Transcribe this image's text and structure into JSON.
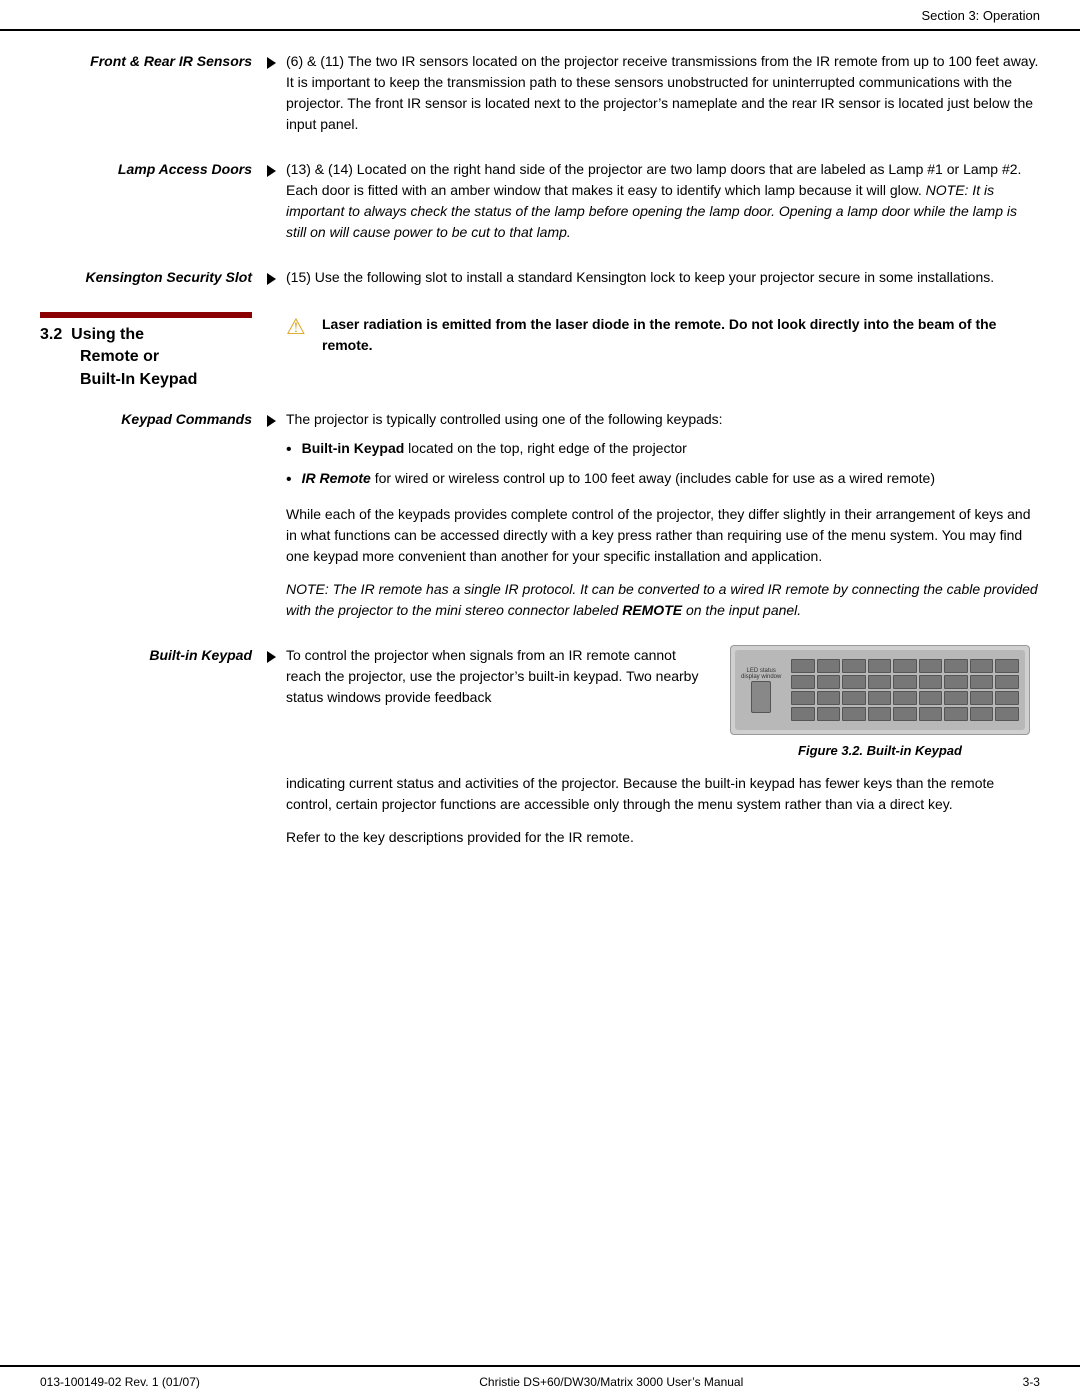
{
  "header": {
    "text": "Section 3: Operation"
  },
  "entries": [
    {
      "id": "front-rear-ir",
      "label": "Front & Rear IR Sensors",
      "content": "(6) & (11) The two IR sensors located on the projector receive transmissions from the IR remote from up to 100 feet away. It is important to keep the transmission path to these sensors unobstructed for uninterrupted communications with the projector. The front IR sensor is located next to the projector’s nameplate and the rear IR sensor is located just below the input panel."
    },
    {
      "id": "lamp-access",
      "label": "Lamp Access Doors",
      "content_parts": [
        "(13) & (14) Located on the right hand side of the projector are two lamp doors that are labeled as Lamp #1 or Lamp #2. Each door is fitted with an amber window that makes it easy to identify which lamp because it will glow.",
        "NOTE: It is important to always check the status of the lamp before opening the lamp door. Opening a lamp door while the lamp is still on will cause power to be cut to that lamp."
      ]
    },
    {
      "id": "kensington",
      "label": "Kensington Security Slot",
      "content": "(15) Use the following slot to install a standard Kensington lock to keep your projector secure in some installations."
    }
  ],
  "section32": {
    "number": "3.2",
    "title_line1": "Using the",
    "title_line2": "Remote or",
    "title_line3": "Built-In Keypad"
  },
  "warning": {
    "icon": "⚠",
    "text": "Laser radiation is emitted from the laser diode in the remote. Do not look directly into the beam of the remote."
  },
  "keypad_commands": {
    "label": "Keypad Commands",
    "intro": "The projector is typically controlled using one of the following keypads:",
    "bullets": [
      {
        "bold": "Built-in Keypad",
        "rest": " located on the top, right edge of the projector"
      },
      {
        "bold": "IR Remote",
        "rest": " for wired or wireless control up to 100 feet away (includes cable for use as a wired remote)"
      }
    ],
    "paragraph1": "While each of the keypads provides complete control of the projector, they differ slightly in their arrangement of keys and in what functions can be accessed directly with a key press rather than requiring use of the menu system. You may find one keypad more convenient than another for your specific installation and application.",
    "note_italic": "NOTE: The IR remote has a single IR protocol. It can be converted to a wired IR remote by connecting the cable provided with the projector to the mini stereo connector labeled",
    "note_bold": "REMOTE",
    "note_end": " on the input panel."
  },
  "builtin_keypad": {
    "label": "Built-in Keypad",
    "text_parts": [
      "To control the projector when signals from an IR remote cannot reach the projector, use the projector’s built-in keypad. Two nearby status windows provide feedback",
      "indicating current status and activities of the projector. Because the built-in keypad has fewer keys than the remote control, certain projector functions are accessible only through the menu system rather than via a direct key."
    ],
    "led_label": "LED status\ndisplay window",
    "figure_caption": "Figure 3.2.  Built-in Keypad"
  },
  "refer_text": "Refer to the key descriptions provided for the IR remote.",
  "footer": {
    "left": "013-100149-02 Rev. 1 (01/07)",
    "center": "Christie DS+60/DW30/Matrix 3000 User’s Manual",
    "right": "3-3"
  }
}
